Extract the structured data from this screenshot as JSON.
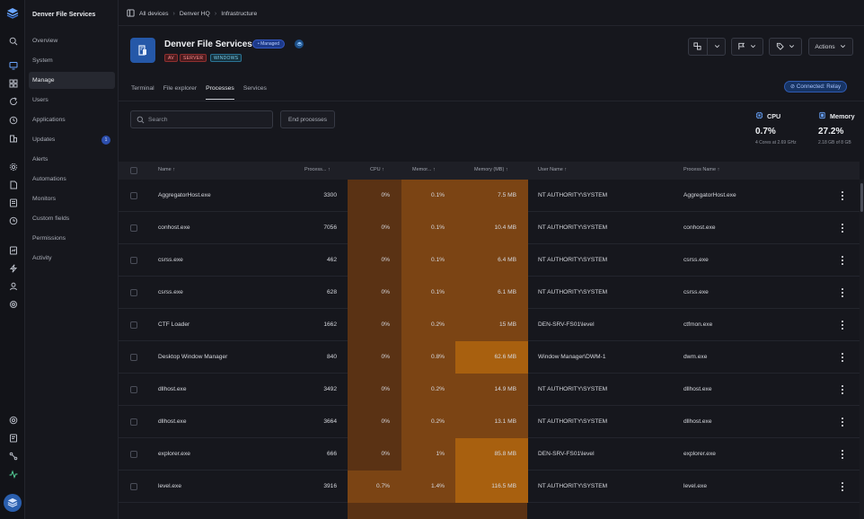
{
  "app": {
    "org_name": "Denver File Services"
  },
  "breadcrumb": [
    "All devices",
    "Denver HQ",
    "Infrastructure"
  ],
  "sidebar": {
    "items": [
      {
        "label": "Overview"
      },
      {
        "label": "System"
      },
      {
        "label": "Manage",
        "active": true
      },
      {
        "label": "Users"
      },
      {
        "label": "Applications"
      },
      {
        "label": "Updates",
        "badge": "1"
      },
      {
        "label": "Alerts"
      },
      {
        "label": "Automations"
      },
      {
        "label": "Monitors"
      },
      {
        "label": "Custom fields"
      },
      {
        "label": "Permissions"
      },
      {
        "label": "Activity"
      }
    ]
  },
  "device": {
    "title": "Denver File Services",
    "managed_label": "• Managed",
    "tags": [
      "AV",
      "SERVER",
      "WINDOWS"
    ]
  },
  "header_actions": {
    "actions_label": "Actions"
  },
  "tabs": [
    "Terminal",
    "File explorer",
    "Processes",
    "Services"
  ],
  "active_tab": "Processes",
  "connection": {
    "label": "Connected: Relay"
  },
  "toolbar": {
    "search_placeholder": "Search",
    "end_processes_label": "End processes"
  },
  "stats": {
    "cpu": {
      "label": "CPU",
      "value": "0.7%",
      "sub": "4 Cores at 2.69 GHz"
    },
    "memory": {
      "label": "Memory",
      "value": "27.2%",
      "sub": "2.18 GB of 8 GB"
    }
  },
  "table": {
    "columns": [
      "Name",
      "Process...",
      "CPU",
      "Memor...",
      "Memory (MB)",
      "User Name",
      "Process Name"
    ],
    "rows": [
      {
        "name": "AggregatorHost.exe",
        "pid": "3300",
        "cpu": "0%",
        "mem_pct": "0.1%",
        "mem_mb": "7.5 MB",
        "user": "NT AUTHORITY\\SYSTEM",
        "process": "AggregatorHost.exe"
      },
      {
        "name": "conhost.exe",
        "pid": "7056",
        "cpu": "0%",
        "mem_pct": "0.1%",
        "mem_mb": "10.4 MB",
        "user": "NT AUTHORITY\\SYSTEM",
        "process": "conhost.exe"
      },
      {
        "name": "csrss.exe",
        "pid": "462",
        "cpu": "0%",
        "mem_pct": "0.1%",
        "mem_mb": "6.4 MB",
        "user": "NT AUTHORITY\\SYSTEM",
        "process": "csrss.exe"
      },
      {
        "name": "csrss.exe",
        "pid": "628",
        "cpu": "0%",
        "mem_pct": "0.1%",
        "mem_mb": "6.1 MB",
        "user": "NT AUTHORITY\\SYSTEM",
        "process": "csrss.exe"
      },
      {
        "name": "CTF Loader",
        "pid": "1662",
        "cpu": "0%",
        "mem_pct": "0.2%",
        "mem_mb": "15 MB",
        "user": "DEN-SRV-FS01\\level",
        "process": "ctfmon.exe"
      },
      {
        "name": "Desktop Window Manager",
        "pid": "840",
        "cpu": "0%",
        "mem_pct": "0.8%",
        "mem_mb": "62.6 MB",
        "user": "Window Manager\\DWM-1",
        "process": "dwm.exe"
      },
      {
        "name": "dllhost.exe",
        "pid": "3492",
        "cpu": "0%",
        "mem_pct": "0.2%",
        "mem_mb": "14.9 MB",
        "user": "NT AUTHORITY\\SYSTEM",
        "process": "dllhost.exe"
      },
      {
        "name": "dllhost.exe",
        "pid": "3664",
        "cpu": "0%",
        "mem_pct": "0.2%",
        "mem_mb": "13.1 MB",
        "user": "NT AUTHORITY\\SYSTEM",
        "process": "dllhost.exe"
      },
      {
        "name": "explorer.exe",
        "pid": "666",
        "cpu": "0%",
        "mem_pct": "1%",
        "mem_mb": "85.8 MB",
        "user": "DEN-SRV-FS01\\level",
        "process": "explorer.exe"
      },
      {
        "name": "level.exe",
        "pid": "3916",
        "cpu": "0.7%",
        "mem_pct": "1.4%",
        "mem_mb": "116.5 MB",
        "user": "NT AUTHORITY\\SYSTEM",
        "process": "level.exe"
      }
    ]
  },
  "colors": {
    "heat_low": "#5a3214",
    "heat_mid": "#7b4414",
    "heat_high": "#a8600f",
    "accent": "#2558a8"
  }
}
